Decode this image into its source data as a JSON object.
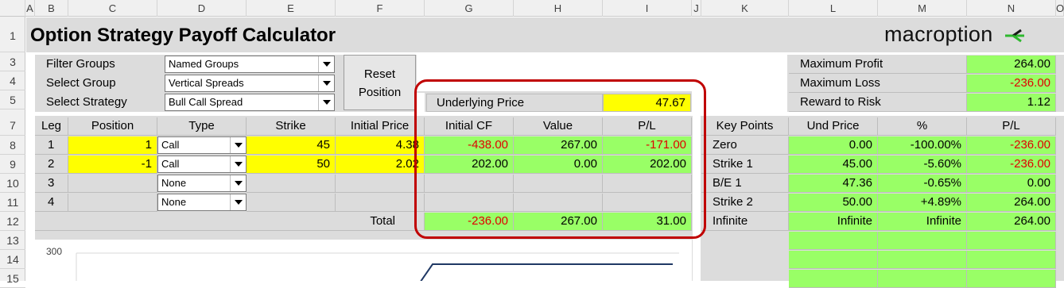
{
  "column_headers": [
    "A",
    "B",
    "C",
    "D",
    "E",
    "F",
    "G",
    "H",
    "I",
    "J",
    "K",
    "L",
    "M",
    "N",
    "O"
  ],
  "row_headers": [
    "1",
    "3",
    "4",
    "5",
    "7",
    "8",
    "9",
    "10",
    "11",
    "12",
    "13",
    "14",
    "15"
  ],
  "title": "Option Strategy Payoff Calculator",
  "logo": {
    "text": "macroption",
    "mark_color": "#2eb82e"
  },
  "filters": {
    "filter_groups_label": "Filter Groups",
    "filter_groups_value": "Named Groups",
    "select_group_label": "Select Group",
    "select_group_value": "Vertical Spreads",
    "select_strategy_label": "Select Strategy",
    "select_strategy_value": "Bull Call Spread"
  },
  "reset_button": {
    "line1": "Reset",
    "line2": "Position"
  },
  "underlying": {
    "label": "Underlying Price",
    "value": "47.67"
  },
  "summary": {
    "max_profit_label": "Maximum Profit",
    "max_profit": "264.00",
    "max_loss_label": "Maximum Loss",
    "max_loss": "-236.00",
    "rr_label": "Reward to Risk",
    "rr": "1.12"
  },
  "legs_table": {
    "headers": [
      "Leg",
      "Position",
      "Type",
      "Strike",
      "Initial Price",
      "Initial CF",
      "Value",
      "P/L"
    ],
    "rows": [
      {
        "leg": "1",
        "position": "1",
        "type": "Call",
        "strike": "45",
        "price": "4.38",
        "cf": "-438.00",
        "value": "267.00",
        "pl": "-171.00"
      },
      {
        "leg": "2",
        "position": "-1",
        "type": "Call",
        "strike": "50",
        "price": "2.02",
        "cf": "202.00",
        "value": "0.00",
        "pl": "202.00"
      },
      {
        "leg": "3",
        "position": "",
        "type": "None",
        "strike": "",
        "price": "",
        "cf": "",
        "value": "",
        "pl": ""
      },
      {
        "leg": "4",
        "position": "",
        "type": "None",
        "strike": "",
        "price": "",
        "cf": "",
        "value": "",
        "pl": ""
      }
    ],
    "total_label": "Total",
    "total_cf": "-236.00",
    "total_value": "267.00",
    "total_pl": "31.00"
  },
  "key_points": {
    "headers": [
      "Key Points",
      "Und Price",
      "%",
      "P/L"
    ],
    "rows": [
      {
        "name": "Zero",
        "price": "0.00",
        "pct": "-100.00%",
        "pl": "-236.00"
      },
      {
        "name": "Strike 1",
        "price": "45.00",
        "pct": "-5.60%",
        "pl": "-236.00"
      },
      {
        "name": "B/E 1",
        "price": "47.36",
        "pct": "-0.65%",
        "pl": "0.00"
      },
      {
        "name": "Strike 2",
        "price": "50.00",
        "pct": "+4.89%",
        "pl": "264.00"
      },
      {
        "name": "Infinite",
        "price": "Infinite",
        "pct": "Infinite",
        "pl": "264.00"
      }
    ]
  },
  "chart": {
    "y_tick_top": "300",
    "line_color": "#1f3864"
  },
  "colors": {
    "yellow": "#ffff00",
    "green": "#99ff66",
    "negative": "#e00000",
    "highlight_box": "#c00000"
  }
}
